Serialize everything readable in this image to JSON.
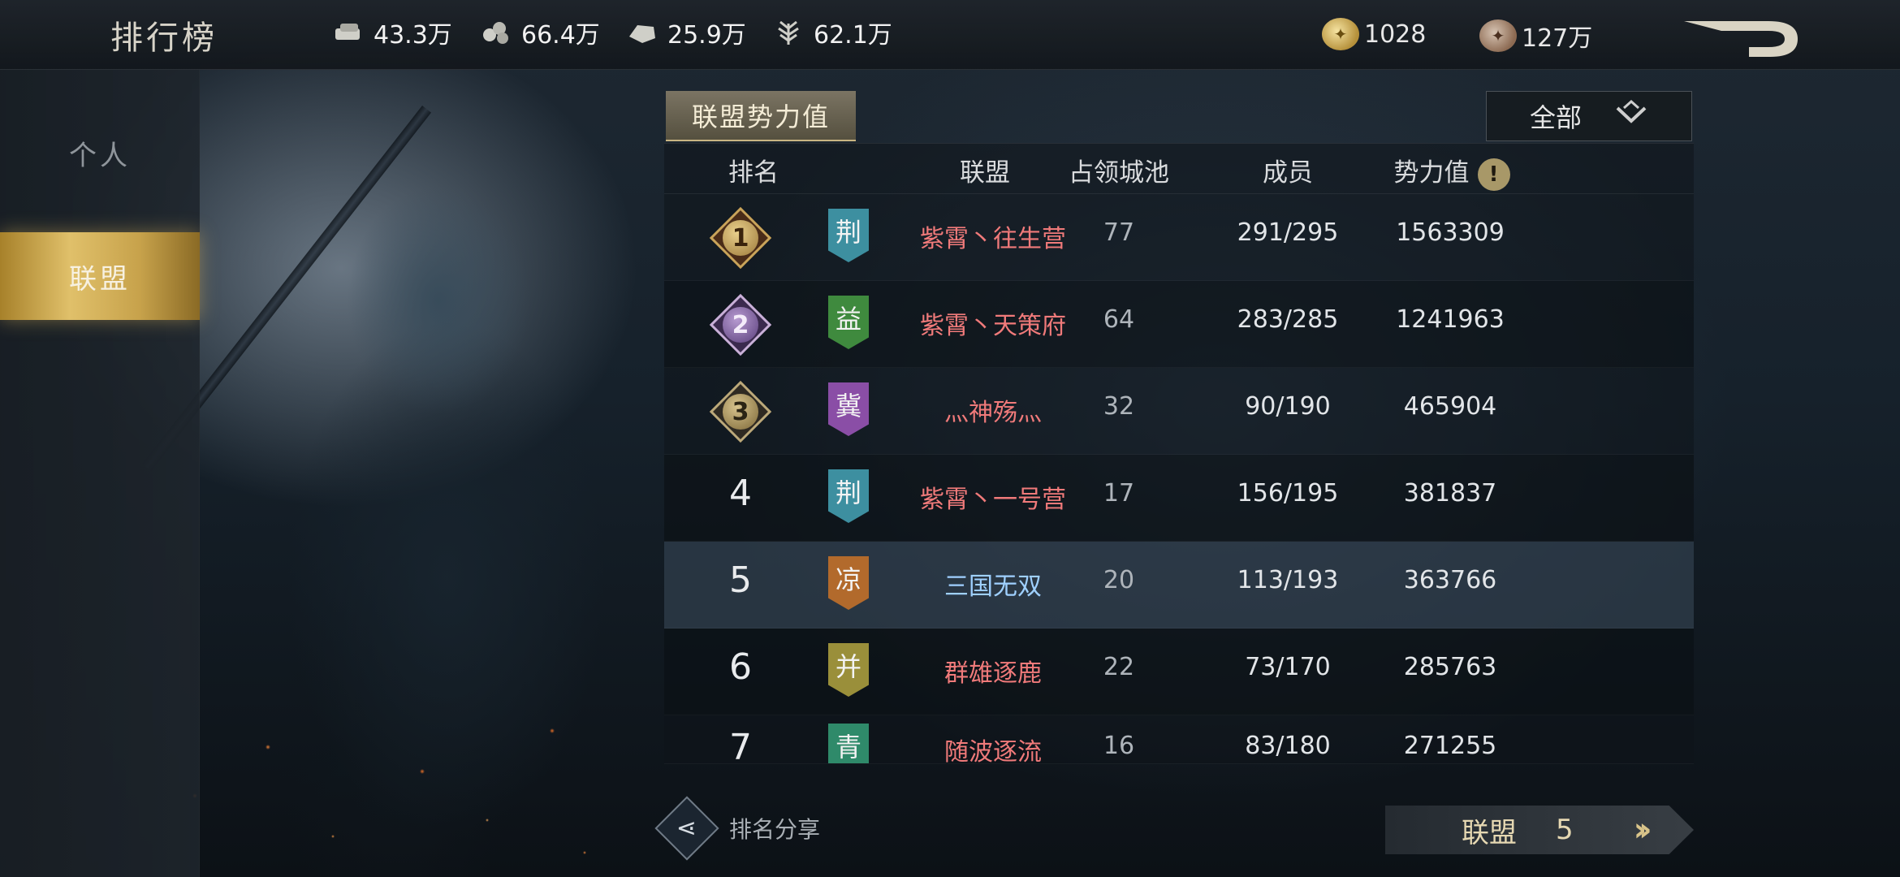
{
  "header": {
    "title": "排行榜",
    "resources": [
      {
        "icon": "wood-icon",
        "value": "43.3万"
      },
      {
        "icon": "iron-icon",
        "value": "66.4万"
      },
      {
        "icon": "stone-icon",
        "value": "25.9万"
      },
      {
        "icon": "grain-icon",
        "value": "62.1万"
      }
    ],
    "gold": "1028",
    "copper": "127万"
  },
  "sidebar": {
    "items": [
      {
        "label": "个人",
        "active": false
      },
      {
        "label": "联盟",
        "active": true
      }
    ]
  },
  "panel": {
    "tab_label": "联盟势力值",
    "filter_label": "全部",
    "columns": [
      "排名",
      "联盟",
      "占领城池",
      "成员",
      "势力值"
    ]
  },
  "rows": [
    {
      "rank": "1",
      "region": "荆",
      "region_color": "#3d8fa0",
      "alliance": "紫霄丶往生营",
      "cities": "77",
      "members": "291/295",
      "power": "1563309"
    },
    {
      "rank": "2",
      "region": "益",
      "region_color": "#3f8a3e",
      "alliance": "紫霄丶天策府",
      "cities": "64",
      "members": "283/285",
      "power": "1241963"
    },
    {
      "rank": "3",
      "region": "冀",
      "region_color": "#8a4ea6",
      "alliance": "灬神殇灬",
      "cities": "32",
      "members": "90/190",
      "power": "465904"
    },
    {
      "rank": "4",
      "region": "荆",
      "region_color": "#3d8fa0",
      "alliance": "紫霄丶一号营",
      "cities": "17",
      "members": "156/195",
      "power": "381837"
    },
    {
      "rank": "5",
      "region": "凉",
      "region_color": "#b26a2c",
      "alliance": "三国无双",
      "cities": "20",
      "members": "113/193",
      "power": "363766"
    },
    {
      "rank": "6",
      "region": "并",
      "region_color": "#9a8f3a",
      "alliance": "群雄逐鹿",
      "cities": "22",
      "members": "73/170",
      "power": "285763"
    },
    {
      "rank": "7",
      "region": "青",
      "region_color": "#2f8a6a",
      "alliance": "随波逐流",
      "cities": "16",
      "members": "83/180",
      "power": "271255"
    }
  ],
  "footer": {
    "share_label": "排名分享",
    "my_rank_label": "联盟",
    "my_rank_value": "5"
  }
}
